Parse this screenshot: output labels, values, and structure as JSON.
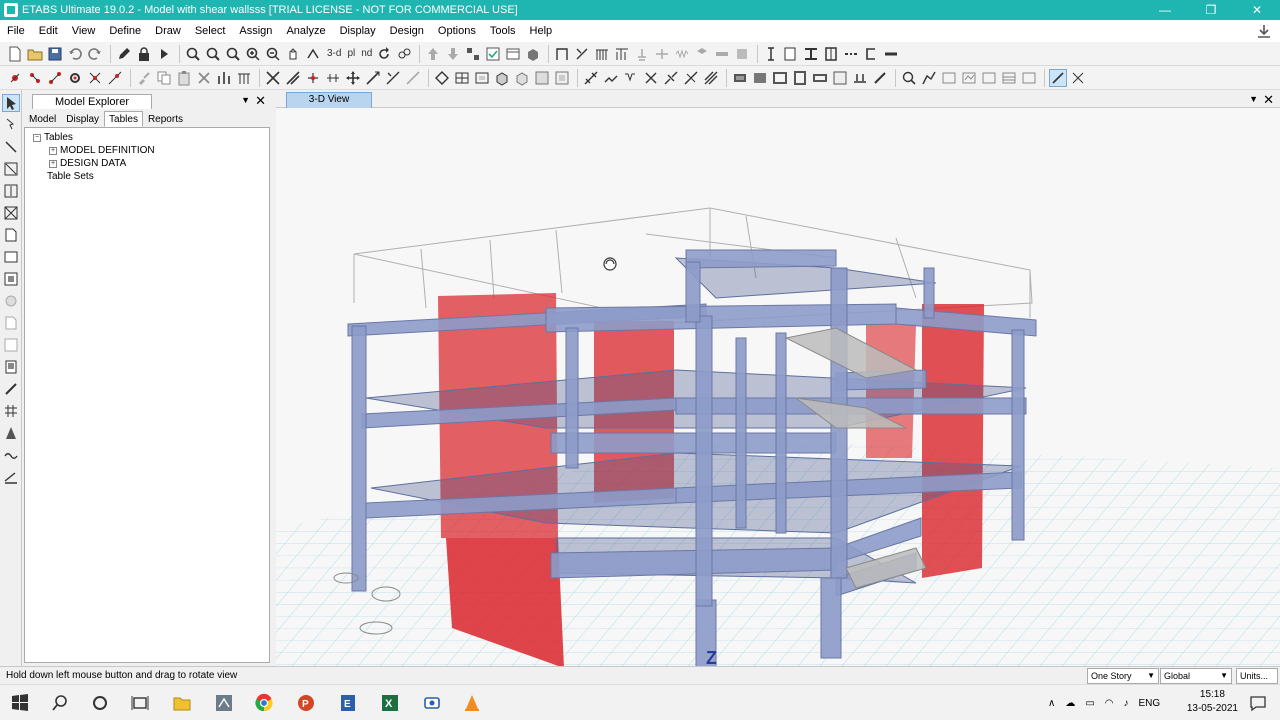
{
  "window": {
    "title": "ETABS Ultimate 19.0.2 - Model with shear wallsss  [TRIAL LICENSE - NOT FOR COMMERCIAL USE]",
    "minimize": "—",
    "maximize": "❐",
    "close": "✕"
  },
  "menu": {
    "items": [
      "File",
      "Edit",
      "View",
      "Define",
      "Draw",
      "Select",
      "Assign",
      "Analyze",
      "Display",
      "Design",
      "Options",
      "Tools",
      "Help"
    ]
  },
  "toolbar": {
    "view_3d_label": "3-d",
    "plan_label": "pl",
    "elev_label": "nd"
  },
  "explorer": {
    "title": "Model Explorer",
    "pin": "▼",
    "close": "✕",
    "tabs": [
      "Model",
      "Display",
      "Tables",
      "Reports"
    ],
    "selected_tab": "Tables",
    "tree": {
      "root": "Tables",
      "children": [
        "MODEL DEFINITION",
        "DESIGN DATA"
      ],
      "sets": "Table Sets"
    }
  },
  "viewport": {
    "tab_label": "3-D View",
    "pin": "▼",
    "close": "✕",
    "axis_label": "Z"
  },
  "status": {
    "message": "Hold down left mouse button and drag to rotate view",
    "story_selector": "One Story",
    "coord_selector": "Global",
    "units_button": "Units..."
  },
  "taskbar": {
    "language": "ENG",
    "time": "15:18",
    "date": "13-05-2021"
  },
  "colors": {
    "titlebar": "#1fb5b0",
    "shear_wall": "#d9242a",
    "frame": "#8d9bc9",
    "slab": "#4a5b8c",
    "grid": "#9fd8e8"
  }
}
